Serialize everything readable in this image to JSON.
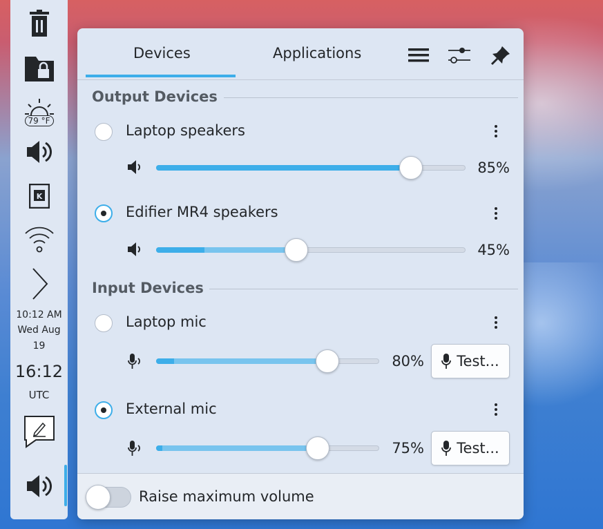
{
  "panel": {
    "weather_temp": "79 °F",
    "clock": {
      "local_time": "10:12 AM",
      "local_date_1": "Wed Aug",
      "local_date_2": "19",
      "utc_time": "16:12",
      "utc_label": "UTC"
    }
  },
  "popup": {
    "tabs": [
      {
        "label": "Devices",
        "active": true
      },
      {
        "label": "Applications",
        "active": false
      }
    ],
    "toolbar_icons": [
      "hamburger-menu-icon",
      "configure-sliders-icon",
      "pin-icon"
    ],
    "sections": {
      "output": {
        "title": "Output Devices",
        "devices": [
          {
            "name": "Laptop speakers",
            "selected": false,
            "volume_label": "85%",
            "volume": 0.85,
            "peak": 0.85
          },
          {
            "name": "Edifier MR4 speakers",
            "selected": true,
            "volume_label": "45%",
            "volume": 0.45,
            "peak": 0.17
          }
        ]
      },
      "input": {
        "title": "Input Devices",
        "devices": [
          {
            "name": "Laptop mic",
            "selected": false,
            "volume_label": "80%",
            "volume": 0.8,
            "peak": 0.09,
            "test_label": "Test..."
          },
          {
            "name": "External mic",
            "selected": true,
            "volume_label": "75%",
            "volume": 0.75,
            "peak": 0.03,
            "test_label": "Test..."
          }
        ]
      }
    },
    "footer": {
      "raise_label": "Raise maximum volume",
      "raise_enabled": false
    }
  },
  "colors": {
    "accent": "#3daee9",
    "accent_light": "#78c4ee",
    "text": "#232629",
    "popup_bg": "#dde6f3"
  }
}
